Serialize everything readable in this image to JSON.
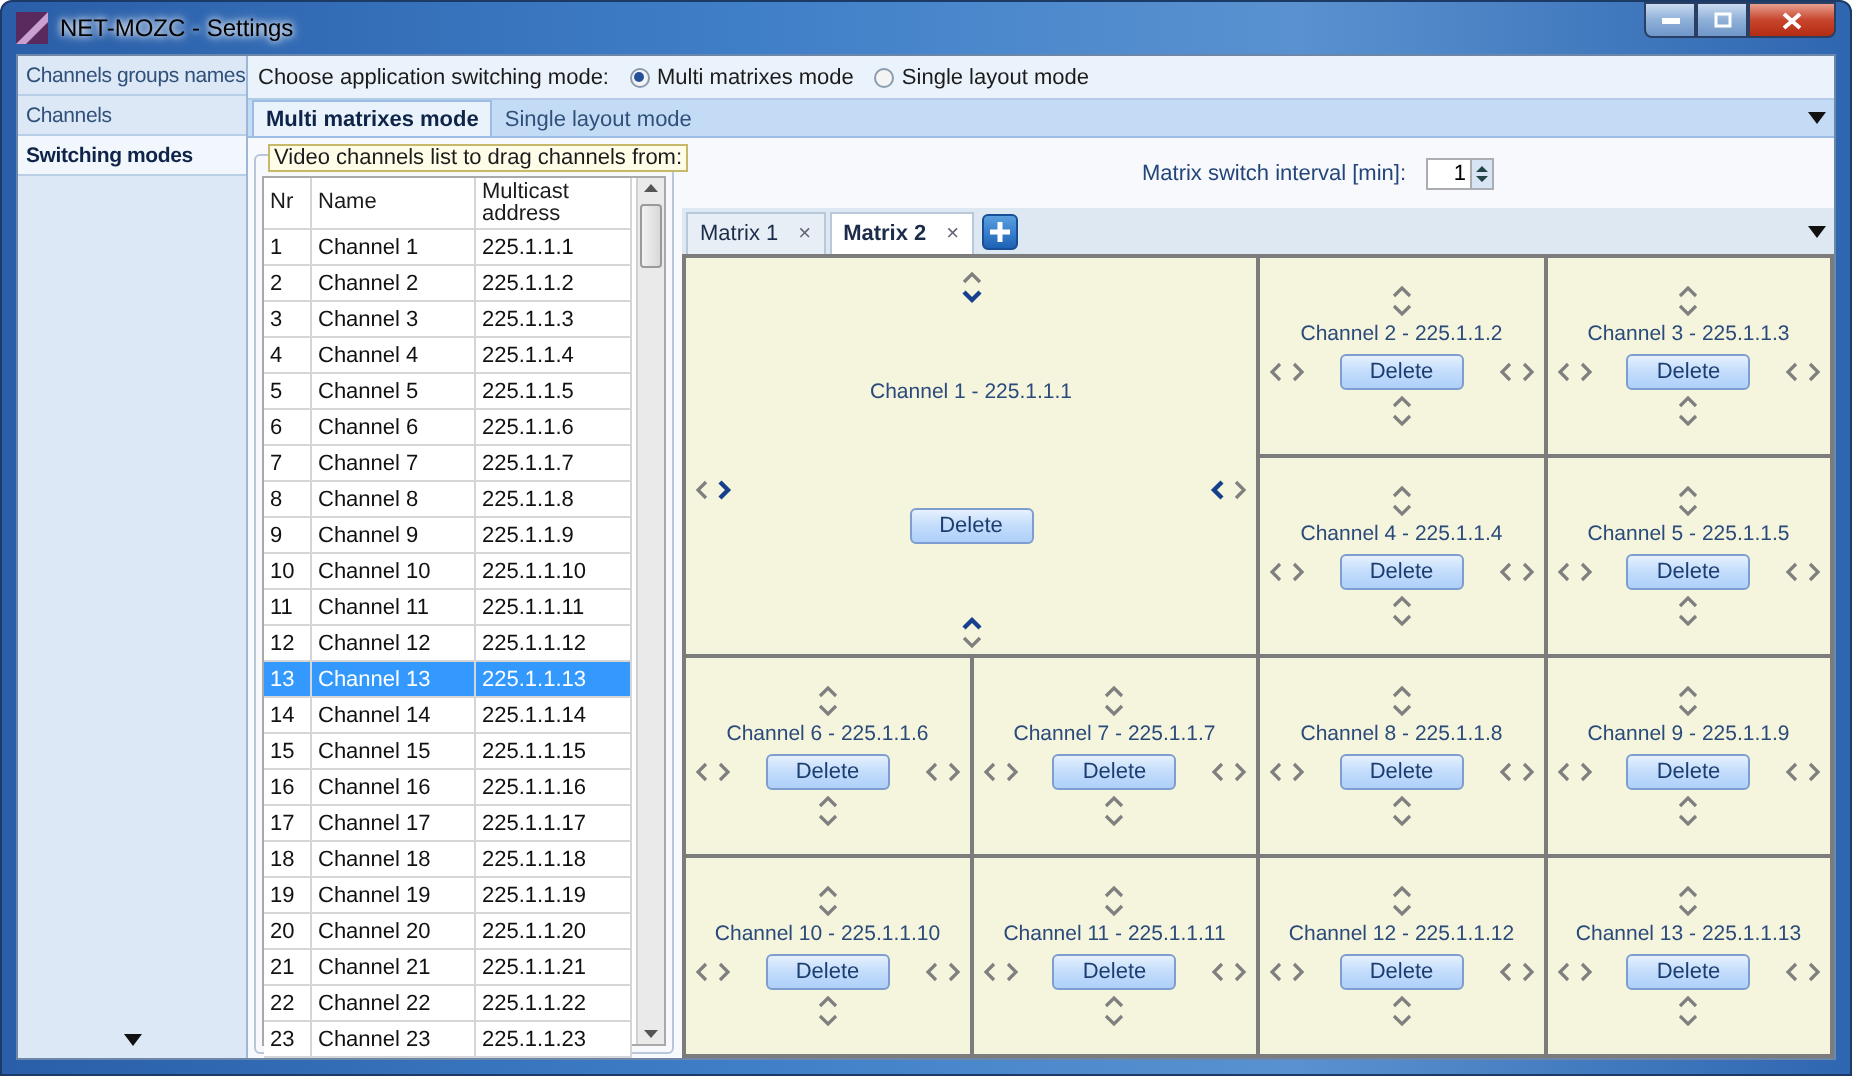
{
  "window": {
    "title": "NET-MOZC - Settings"
  },
  "sidebar": {
    "items": [
      {
        "label": "Channels groups names",
        "selected": false
      },
      {
        "label": "Channels",
        "selected": false
      },
      {
        "label": "Switching modes",
        "selected": true
      }
    ]
  },
  "switching_mode": {
    "label": "Choose application switching mode:",
    "options": [
      {
        "label": "Multi matrixes mode",
        "selected": true
      },
      {
        "label": "Single layout mode",
        "selected": false
      }
    ]
  },
  "mode_tabs": [
    {
      "label": "Multi matrixes mode",
      "selected": true
    },
    {
      "label": "Single layout mode",
      "selected": false
    }
  ],
  "channel_list": {
    "title": "Video channels list to drag channels from:",
    "columns": [
      "Nr",
      "Name",
      "Multicast address"
    ],
    "rows": [
      {
        "nr": "1",
        "name": "Channel 1",
        "address": "225.1.1.1",
        "selected": false
      },
      {
        "nr": "2",
        "name": "Channel 2",
        "address": "225.1.1.2",
        "selected": false
      },
      {
        "nr": "3",
        "name": "Channel 3",
        "address": "225.1.1.3",
        "selected": false
      },
      {
        "nr": "4",
        "name": "Channel 4",
        "address": "225.1.1.4",
        "selected": false
      },
      {
        "nr": "5",
        "name": "Channel 5",
        "address": "225.1.1.5",
        "selected": false
      },
      {
        "nr": "6",
        "name": "Channel 6",
        "address": "225.1.1.6",
        "selected": false
      },
      {
        "nr": "7",
        "name": "Channel 7",
        "address": "225.1.1.7",
        "selected": false
      },
      {
        "nr": "8",
        "name": "Channel 8",
        "address": "225.1.1.8",
        "selected": false
      },
      {
        "nr": "9",
        "name": "Channel 9",
        "address": "225.1.1.9",
        "selected": false
      },
      {
        "nr": "10",
        "name": "Channel 10",
        "address": "225.1.1.10",
        "selected": false
      },
      {
        "nr": "11",
        "name": "Channel 11",
        "address": "225.1.1.11",
        "selected": false
      },
      {
        "nr": "12",
        "name": "Channel 12",
        "address": "225.1.1.12",
        "selected": false
      },
      {
        "nr": "13",
        "name": "Channel 13",
        "address": "225.1.1.13",
        "selected": true
      },
      {
        "nr": "14",
        "name": "Channel 14",
        "address": "225.1.1.14",
        "selected": false
      },
      {
        "nr": "15",
        "name": "Channel 15",
        "address": "225.1.1.15",
        "selected": false
      },
      {
        "nr": "16",
        "name": "Channel 16",
        "address": "225.1.1.16",
        "selected": false
      },
      {
        "nr": "17",
        "name": "Channel 17",
        "address": "225.1.1.17",
        "selected": false
      },
      {
        "nr": "18",
        "name": "Channel 18",
        "address": "225.1.1.18",
        "selected": false
      },
      {
        "nr": "19",
        "name": "Channel 19",
        "address": "225.1.1.19",
        "selected": false
      },
      {
        "nr": "20",
        "name": "Channel 20",
        "address": "225.1.1.20",
        "selected": false
      },
      {
        "nr": "21",
        "name": "Channel 21",
        "address": "225.1.1.21",
        "selected": false
      },
      {
        "nr": "22",
        "name": "Channel 22",
        "address": "225.1.1.22",
        "selected": false
      },
      {
        "nr": "23",
        "name": "Channel 23",
        "address": "225.1.1.23",
        "selected": false
      }
    ]
  },
  "interval": {
    "label": "Matrix switch interval [min]:",
    "value": "1"
  },
  "matrix_tabs": [
    {
      "label": "Matrix 1",
      "close": "×",
      "selected": false
    },
    {
      "label": "Matrix 2",
      "close": "×",
      "selected": true
    }
  ],
  "tiles": [
    {
      "label": "Channel 1 - 225.1.1.1",
      "button": "Delete",
      "kind": "large"
    },
    {
      "label": "Channel 2 - 225.1.1.2",
      "button": "Delete",
      "kind": "small"
    },
    {
      "label": "Channel 3 - 225.1.1.3",
      "button": "Delete",
      "kind": "small"
    },
    {
      "label": "Channel 4 - 225.1.1.4",
      "button": "Delete",
      "kind": "small"
    },
    {
      "label": "Channel 5 - 225.1.1.5",
      "button": "Delete",
      "kind": "small"
    },
    {
      "label": "Channel 6 - 225.1.1.6",
      "button": "Delete",
      "kind": "small"
    },
    {
      "label": "Channel 7 - 225.1.1.7",
      "button": "Delete",
      "kind": "small"
    },
    {
      "label": "Channel 8 - 225.1.1.8",
      "button": "Delete",
      "kind": "small"
    },
    {
      "label": "Channel 9 - 225.1.1.9",
      "button": "Delete",
      "kind": "small"
    },
    {
      "label": "Channel 10 - 225.1.1.10",
      "button": "Delete",
      "kind": "small"
    },
    {
      "label": "Channel 11 - 225.1.1.11",
      "button": "Delete",
      "kind": "small"
    },
    {
      "label": "Channel 12 - 225.1.1.12",
      "button": "Delete",
      "kind": "small"
    },
    {
      "label": "Channel 13 - 225.1.1.13",
      "button": "Delete",
      "kind": "small"
    }
  ]
}
